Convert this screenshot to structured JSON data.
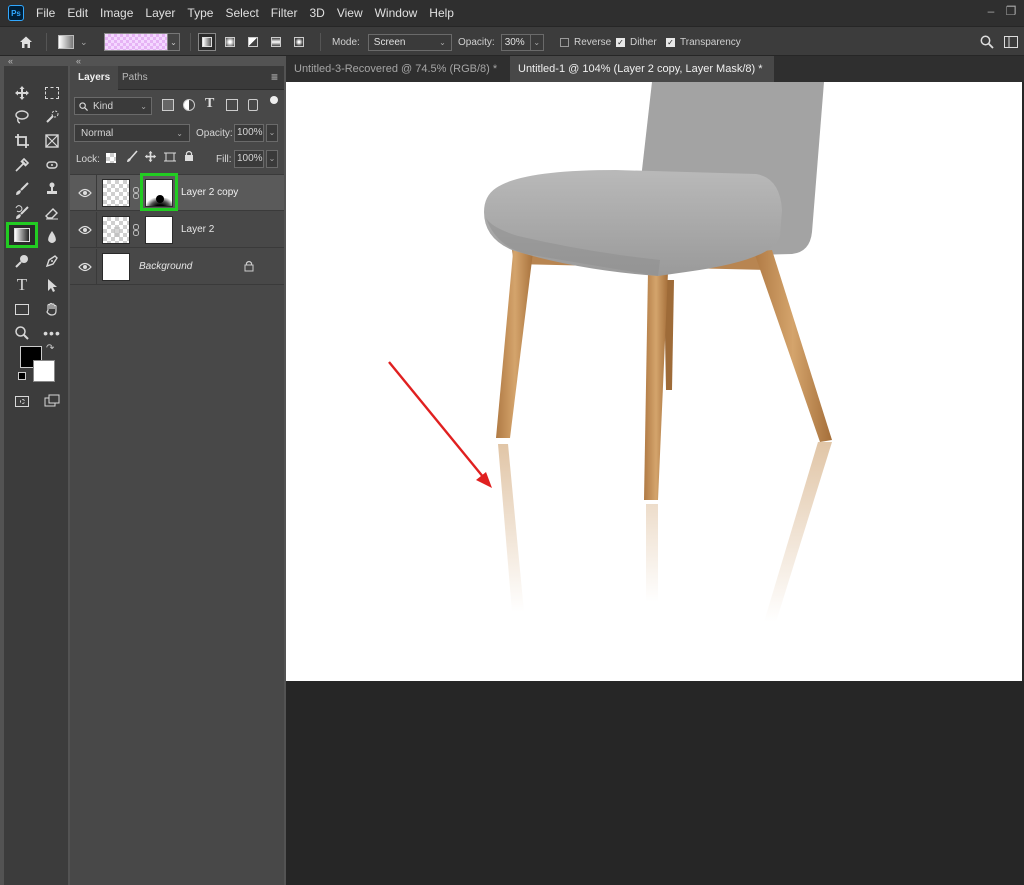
{
  "app": {
    "logo": "Ps"
  },
  "menu": [
    "File",
    "Edit",
    "Image",
    "Layer",
    "Type",
    "Select",
    "Filter",
    "3D",
    "View",
    "Window",
    "Help"
  ],
  "options": {
    "mode_label": "Mode:",
    "mode_value": "Screen",
    "opacity_label": "Opacity:",
    "opacity_value": "30%",
    "reverse_label": "Reverse",
    "dither_label": "Dither",
    "transparency_label": "Transparency",
    "reverse_checked": false,
    "dither_checked": true,
    "transparency_checked": true
  },
  "layers_panel": {
    "tabs": [
      "Layers",
      "Paths"
    ],
    "filter_kind": "Kind",
    "blend_mode": "Normal",
    "opacity_label": "Opacity:",
    "opacity_value": "100%",
    "lock_label": "Lock:",
    "fill_label": "Fill:",
    "fill_value": "100%",
    "layers": [
      {
        "name": "Layer 2 copy",
        "selected": true,
        "has_mask": true
      },
      {
        "name": "Layer 2",
        "selected": false,
        "has_mask": true
      },
      {
        "name": "Background",
        "selected": false,
        "locked": true
      }
    ]
  },
  "documents": {
    "tabs": [
      {
        "title": "Untitled-3-Recovered @ 74.5% (RGB/8) *",
        "active": false
      },
      {
        "title": "Untitled-1 @ 104% (Layer 2 copy, Layer Mask/8) *",
        "active": true
      }
    ]
  },
  "colors": {
    "highlight": "#22cc22",
    "arrow": "#e02020",
    "chair_seat": "#a9a9a9",
    "chair_wood": "#c8965e"
  }
}
